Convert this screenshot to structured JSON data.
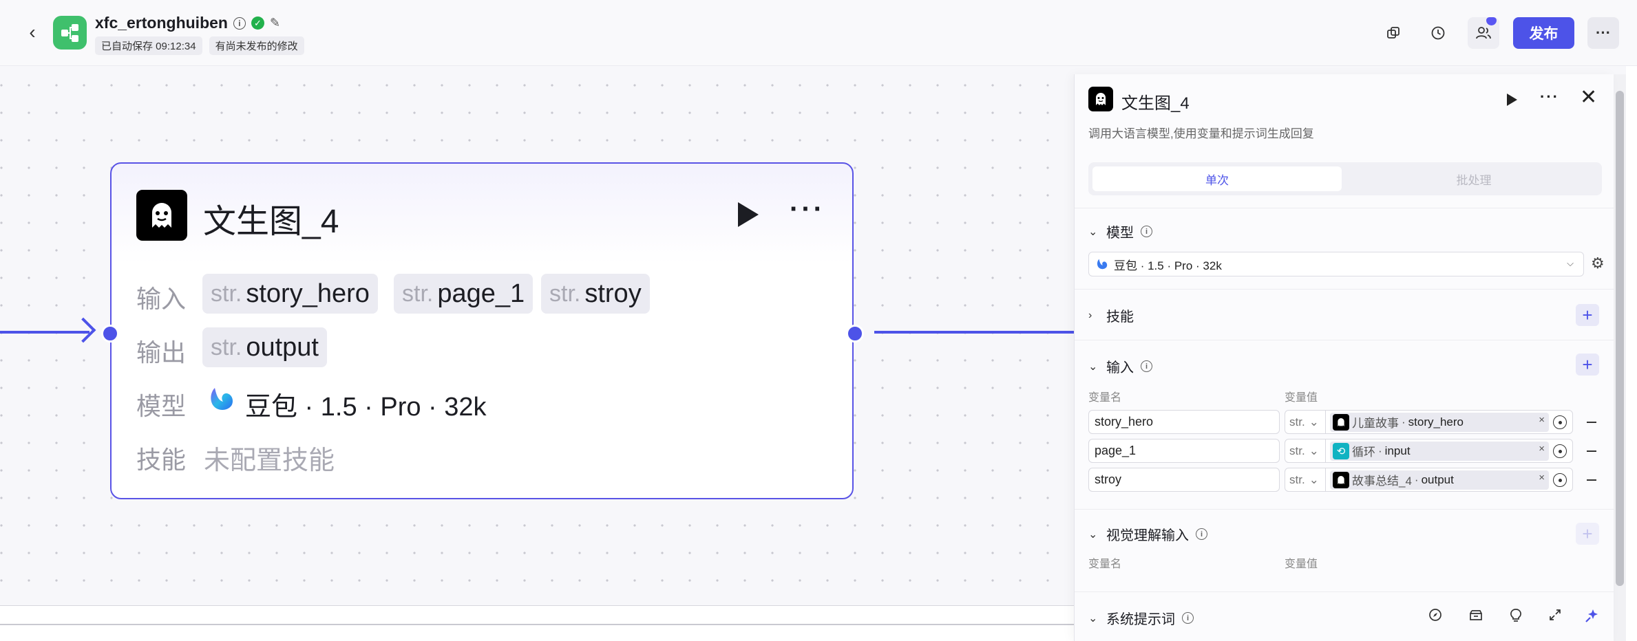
{
  "header": {
    "app_name": "xfc_ertonghuiben",
    "autosave": "已自动保存 09:12:34",
    "unpublished": "有尚未发布的修改",
    "publish_label": "发布"
  },
  "node": {
    "title": "文生图_4",
    "input_label": "输入",
    "output_label": "输出",
    "model_label": "模型",
    "skill_label": "技能",
    "type_prefix": "str.",
    "inputs": [
      "story_hero",
      "page_1",
      "stroy"
    ],
    "output": "output",
    "model": "豆包 · 1.5 · Pro · 32k",
    "skill_value": "未配置技能"
  },
  "panel": {
    "title": "文生图_4",
    "description": "调用大语言模型,使用变量和提示词生成回复",
    "tabs": {
      "single": "单次",
      "batch": "批处理"
    },
    "model_section": "模型",
    "model_value": "豆包 · 1.5 · Pro · 32k",
    "skills_section": "技能",
    "input_section": "输入",
    "var_name_header": "变量名",
    "var_value_header": "变量值",
    "type_label": "str.",
    "rows": [
      {
        "name": "story_hero",
        "source": "儿童故事",
        "field": "story_hero",
        "icon": "ghost-icon"
      },
      {
        "name": "page_1",
        "source": "循环",
        "field": "input",
        "icon": "loop-icon"
      },
      {
        "name": "stroy",
        "source": "故事总结_4",
        "field": "output",
        "icon": "ghost-icon"
      }
    ],
    "vision_section": "视觉理解输入",
    "vision_var_name_header": "变量名",
    "vision_var_value_header": "变量值",
    "system_prompt_section": "系统提示词",
    "separator": " · "
  },
  "colors": {
    "accent": "#4d53e8",
    "logo_green": "#3fc06c"
  }
}
